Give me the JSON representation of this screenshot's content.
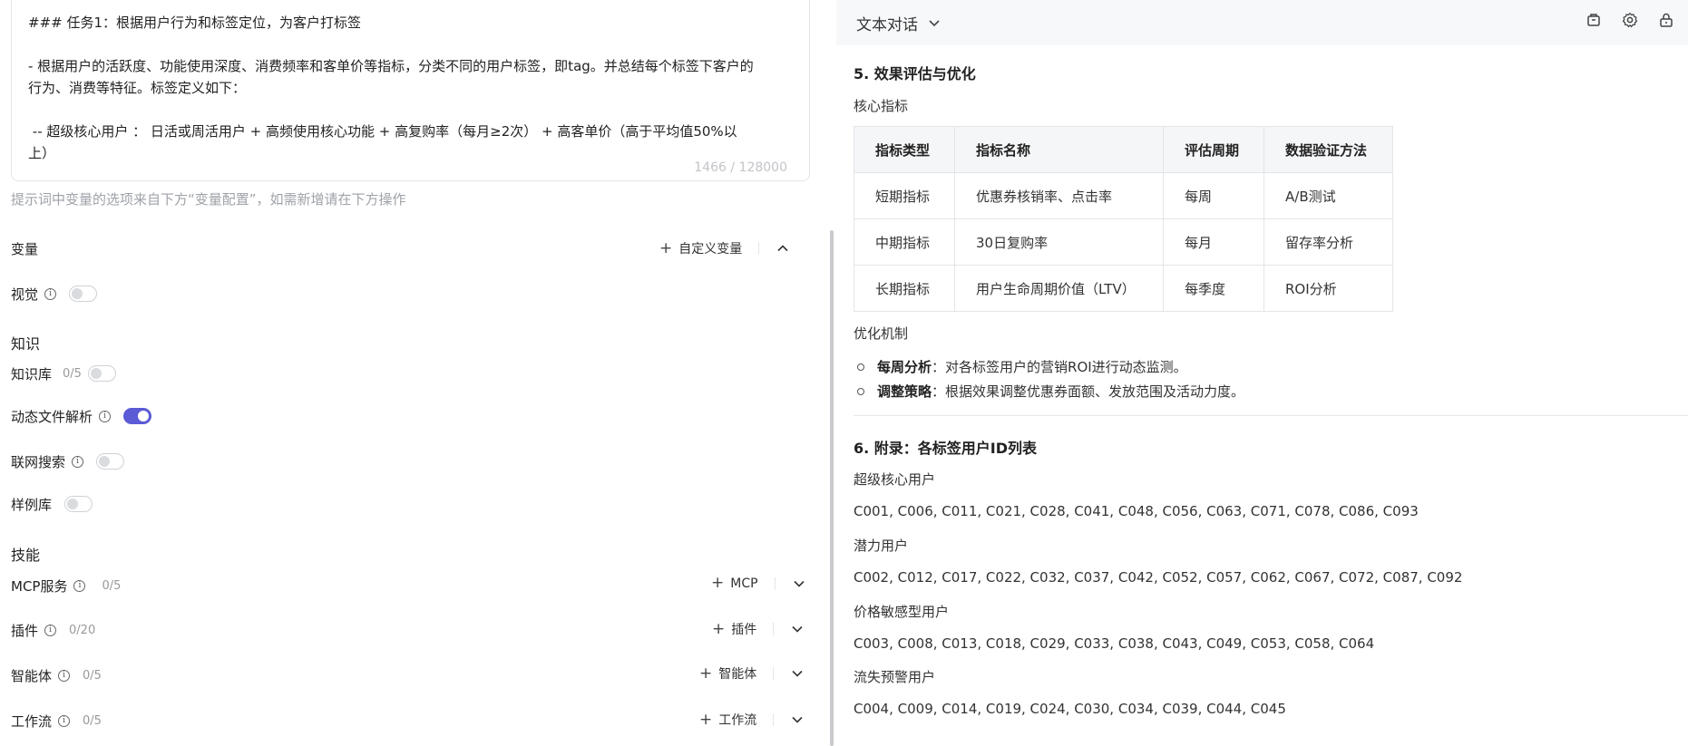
{
  "prompt": {
    "lines": [
      "### 任务1：根据用户行为和标签定位，为客户打标签",
      "",
      "- 根据用户的活跃度、功能使用深度、消费频率和客单价等指标，分类不同的用户标签，即tag。并总结每个标签下客户的",
      "行为、消费等特征。标签定义如下：",
      "",
      " -- 超级核心用户 ： 日活或周活用户 + 高频使用核心功能 + 高复购率（每月≥2次） + 高客单价（高于平均值50%以",
      "上）"
    ],
    "counter": "1466 / 128000"
  },
  "hint": "提示词中变量的选项来自下方“变量配置”，如需新增请在下方操作",
  "variables": {
    "title": "变量",
    "custom_label": "自定义变量"
  },
  "vision": {
    "label": "视觉",
    "on": false
  },
  "knowledge": {
    "title": "知识",
    "kb": {
      "label": "知识库",
      "count": "0/5",
      "on": false
    },
    "dynamic": {
      "label": "动态文件解析",
      "on": true
    },
    "web": {
      "label": "联网搜索",
      "on": false
    },
    "samples": {
      "label": "样例库",
      "on": false
    }
  },
  "skills": {
    "title": "技能",
    "items": [
      {
        "label": "MCP服务",
        "count": "0/5",
        "add": "MCP"
      },
      {
        "label": "插件",
        "count": "0/20",
        "add": "插件"
      },
      {
        "label": "智能体",
        "count": "0/5",
        "add": "智能体"
      },
      {
        "label": "工作流",
        "count": "0/5",
        "add": "工作流"
      }
    ]
  },
  "right": {
    "header_title": "文本对话",
    "section5_title": "5. 效果评估与优化",
    "core_metrics_label": "核心指标",
    "table": {
      "headers": [
        "指标类型",
        "指标名称",
        "评估周期",
        "数据验证方法"
      ],
      "rows": [
        [
          "短期指标",
          "优惠券核销率、点击率",
          "每周",
          "A/B测试"
        ],
        [
          "中期指标",
          "30日复购率",
          "每月",
          "留存率分析"
        ],
        [
          "长期指标",
          "用户生命周期价值（LTV）",
          "每季度",
          "ROI分析"
        ]
      ]
    },
    "optimization_label": "优化机制",
    "bullets": [
      {
        "bold": "每周分析",
        "text": "：对各标签用户的营销ROI进行动态监测。"
      },
      {
        "bold": "调整策略",
        "text": "：根据效果调整优惠券面额、发放范围及活动力度。"
      }
    ],
    "section6_title": "6. 附录：各标签用户ID列表",
    "groups": [
      {
        "name": "超级核心用户",
        "ids": "C001, C006, C011, C021, C028, C041, C048, C056, C063, C071, C078, C086, C093"
      },
      {
        "name": "潜力用户",
        "ids": "C002, C012, C017, C022, C032, C037, C042, C052, C057, C062, C067, C072, C087, C092"
      },
      {
        "name": "价格敏感型用户",
        "ids": "C003, C008, C013, C018, C029, C033, C038, C043, C049, C053, C058, C064"
      },
      {
        "name": "流失预警用户",
        "ids": "C004, C009, C014, C019, C024, C030, C034, C039, C044, C045"
      }
    ]
  },
  "colors": {
    "accent": "#5b5bd6",
    "header_bg": "#f7f8fa",
    "table_header_bg": "#f5f6f8"
  }
}
